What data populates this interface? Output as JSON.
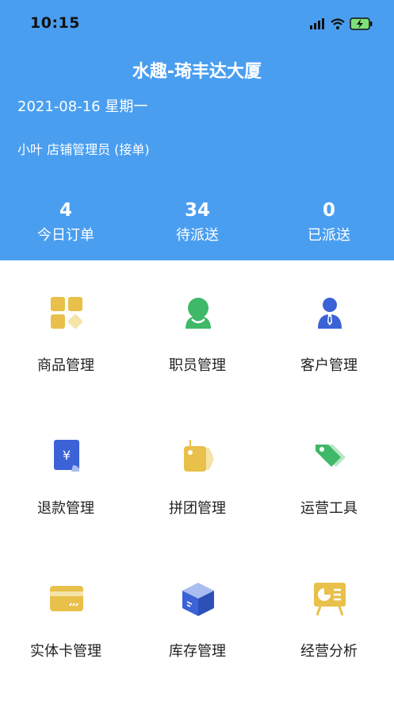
{
  "status_bar": {
    "time": "10:15"
  },
  "header": {
    "store_name": "水趣-琦丰达大厦",
    "date": "2021-08-16 星期一",
    "user": "小叶 店铺管理员 (接单)"
  },
  "stats": [
    {
      "value": "4",
      "label": "今日订单"
    },
    {
      "value": "34",
      "label": "待派送"
    },
    {
      "value": "0",
      "label": "已派送"
    }
  ],
  "menu": [
    {
      "label": "商品管理",
      "icon": "product-grid-icon"
    },
    {
      "label": "职员管理",
      "icon": "staff-icon"
    },
    {
      "label": "客户管理",
      "icon": "customer-icon"
    },
    {
      "label": "退款管理",
      "icon": "refund-icon"
    },
    {
      "label": "拼团管理",
      "icon": "group-buy-tag-icon"
    },
    {
      "label": "运营工具",
      "icon": "operation-tag-icon"
    },
    {
      "label": "实体卡管理",
      "icon": "card-icon"
    },
    {
      "label": "库存管理",
      "icon": "inventory-box-icon"
    },
    {
      "label": "经营分析",
      "icon": "analysis-board-icon"
    }
  ],
  "colors": {
    "header_bg": "#4a9ef0",
    "yellow": "#e8c04a",
    "green": "#3fb868",
    "blue": "#3b62d6"
  }
}
